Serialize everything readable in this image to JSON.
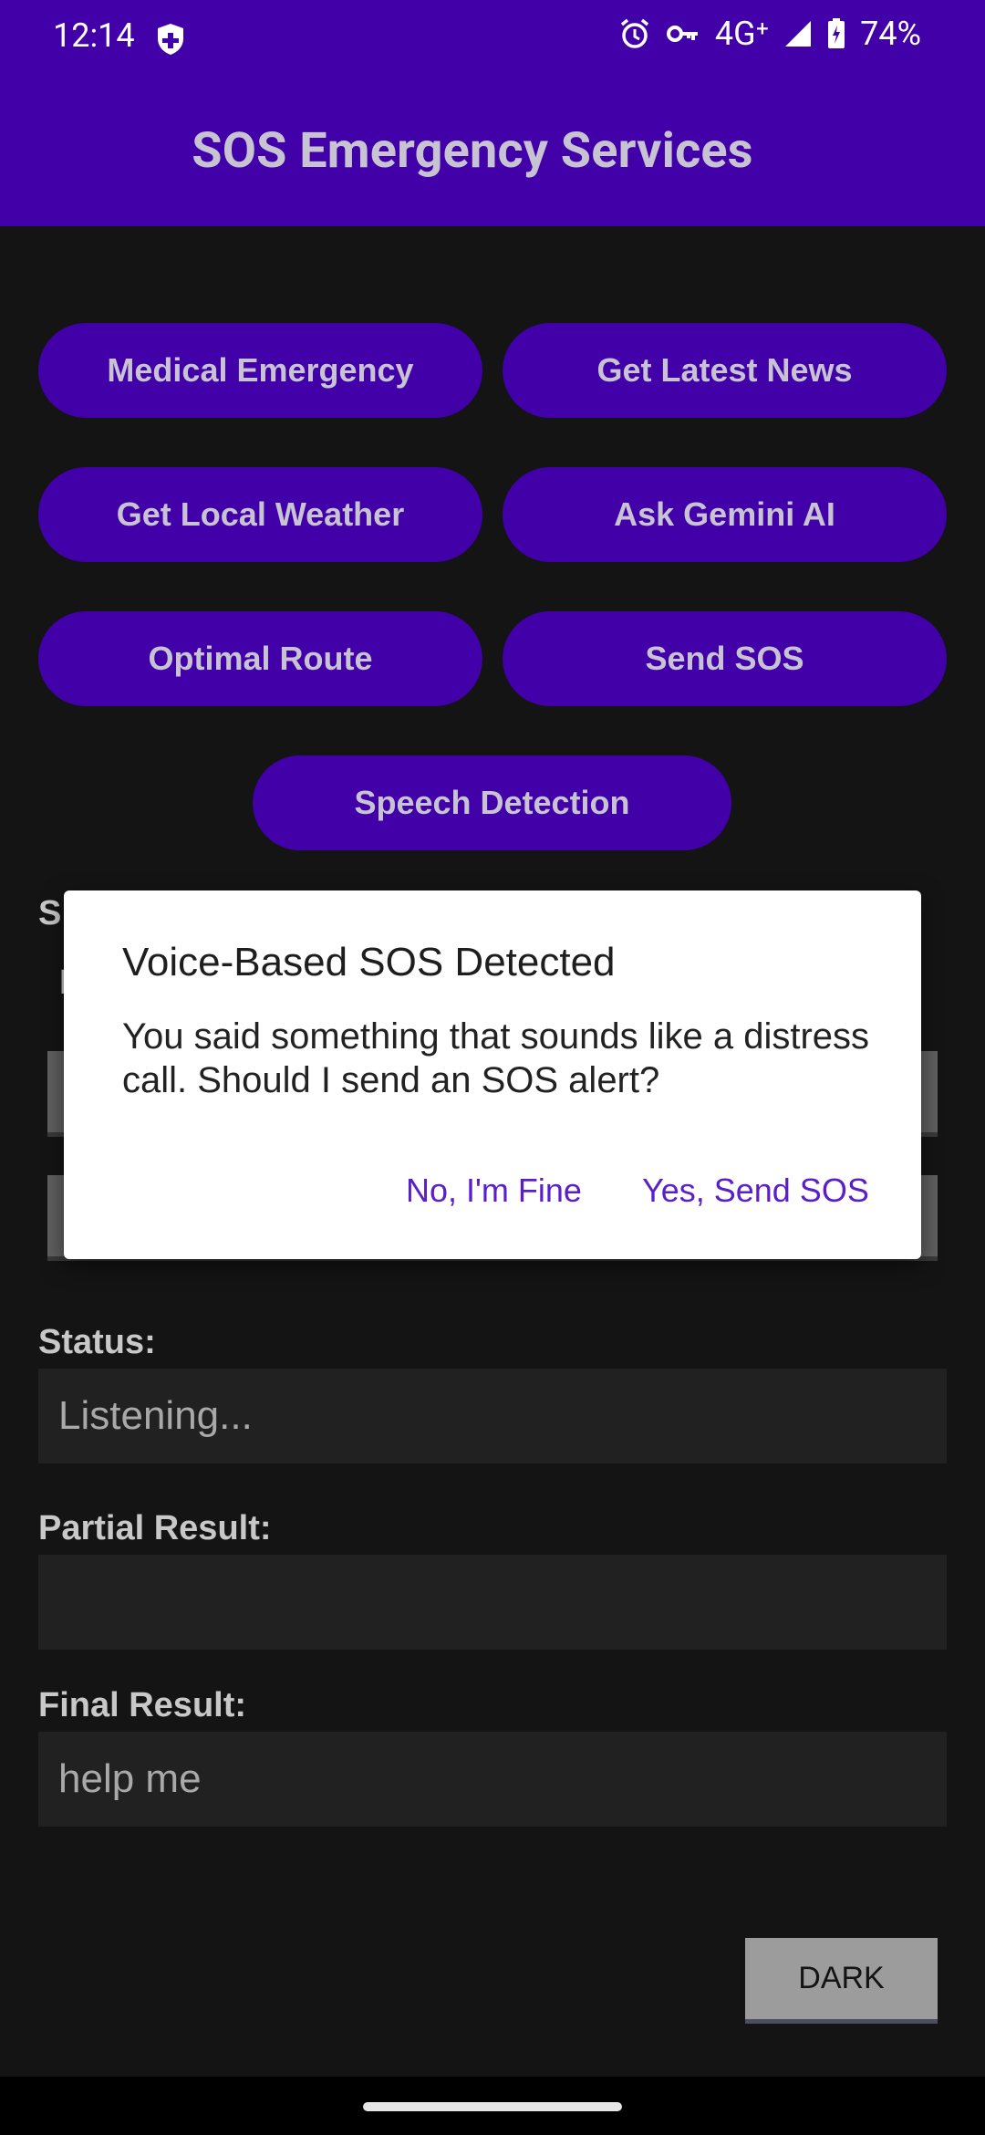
{
  "status_bar": {
    "time": "12:14",
    "network": "4G⁺",
    "battery": "74%"
  },
  "app_bar": {
    "title": "SOS Emergency Services"
  },
  "buttons": {
    "medical": "Medical Emergency",
    "news": "Get Latest News",
    "weather": "Get Local Weather",
    "gemini": "Ask Gemini AI",
    "route": "Optimal Route",
    "sos": "Send SOS",
    "speech": "Speech Detection"
  },
  "obscured": {
    "label_fragment": "S",
    "row_fragment": "I"
  },
  "status": {
    "label": "Status:",
    "value": "Listening..."
  },
  "partial": {
    "label": "Partial Result:",
    "value": ""
  },
  "final": {
    "label": "Final Result:",
    "value": "help me"
  },
  "theme_button": "DARK",
  "dialog": {
    "title": "Voice-Based SOS Detected",
    "message": "You said something that sounds like a distress call. Should I send an SOS alert?",
    "negative": "No, I'm Fine",
    "positive": "Yes, Send SOS"
  },
  "colors": {
    "primary": "#4100a8",
    "background": "#141414",
    "accent": "#5a1fc9"
  },
  "icons": [
    "shield-icon",
    "alarm-icon",
    "vpn-key-icon",
    "signal-icon",
    "battery-icon"
  ]
}
